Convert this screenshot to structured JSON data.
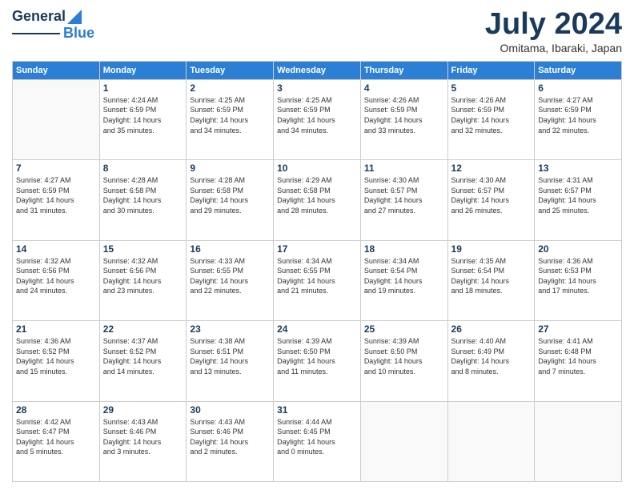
{
  "logo": {
    "line1": "General",
    "line2": "Blue"
  },
  "header": {
    "month": "July 2024",
    "location": "Omitama, Ibaraki, Japan"
  },
  "weekdays": [
    "Sunday",
    "Monday",
    "Tuesday",
    "Wednesday",
    "Thursday",
    "Friday",
    "Saturday"
  ],
  "weeks": [
    [
      {
        "day": "",
        "info": ""
      },
      {
        "day": "1",
        "info": "Sunrise: 4:24 AM\nSunset: 6:59 PM\nDaylight: 14 hours\nand 35 minutes."
      },
      {
        "day": "2",
        "info": "Sunrise: 4:25 AM\nSunset: 6:59 PM\nDaylight: 14 hours\nand 34 minutes."
      },
      {
        "day": "3",
        "info": "Sunrise: 4:25 AM\nSunset: 6:59 PM\nDaylight: 14 hours\nand 34 minutes."
      },
      {
        "day": "4",
        "info": "Sunrise: 4:26 AM\nSunset: 6:59 PM\nDaylight: 14 hours\nand 33 minutes."
      },
      {
        "day": "5",
        "info": "Sunrise: 4:26 AM\nSunset: 6:59 PM\nDaylight: 14 hours\nand 32 minutes."
      },
      {
        "day": "6",
        "info": "Sunrise: 4:27 AM\nSunset: 6:59 PM\nDaylight: 14 hours\nand 32 minutes."
      }
    ],
    [
      {
        "day": "7",
        "info": "Sunrise: 4:27 AM\nSunset: 6:59 PM\nDaylight: 14 hours\nand 31 minutes."
      },
      {
        "day": "8",
        "info": "Sunrise: 4:28 AM\nSunset: 6:58 PM\nDaylight: 14 hours\nand 30 minutes."
      },
      {
        "day": "9",
        "info": "Sunrise: 4:28 AM\nSunset: 6:58 PM\nDaylight: 14 hours\nand 29 minutes."
      },
      {
        "day": "10",
        "info": "Sunrise: 4:29 AM\nSunset: 6:58 PM\nDaylight: 14 hours\nand 28 minutes."
      },
      {
        "day": "11",
        "info": "Sunrise: 4:30 AM\nSunset: 6:57 PM\nDaylight: 14 hours\nand 27 minutes."
      },
      {
        "day": "12",
        "info": "Sunrise: 4:30 AM\nSunset: 6:57 PM\nDaylight: 14 hours\nand 26 minutes."
      },
      {
        "day": "13",
        "info": "Sunrise: 4:31 AM\nSunset: 6:57 PM\nDaylight: 14 hours\nand 25 minutes."
      }
    ],
    [
      {
        "day": "14",
        "info": "Sunrise: 4:32 AM\nSunset: 6:56 PM\nDaylight: 14 hours\nand 24 minutes."
      },
      {
        "day": "15",
        "info": "Sunrise: 4:32 AM\nSunset: 6:56 PM\nDaylight: 14 hours\nand 23 minutes."
      },
      {
        "day": "16",
        "info": "Sunrise: 4:33 AM\nSunset: 6:55 PM\nDaylight: 14 hours\nand 22 minutes."
      },
      {
        "day": "17",
        "info": "Sunrise: 4:34 AM\nSunset: 6:55 PM\nDaylight: 14 hours\nand 21 minutes."
      },
      {
        "day": "18",
        "info": "Sunrise: 4:34 AM\nSunset: 6:54 PM\nDaylight: 14 hours\nand 19 minutes."
      },
      {
        "day": "19",
        "info": "Sunrise: 4:35 AM\nSunset: 6:54 PM\nDaylight: 14 hours\nand 18 minutes."
      },
      {
        "day": "20",
        "info": "Sunrise: 4:36 AM\nSunset: 6:53 PM\nDaylight: 14 hours\nand 17 minutes."
      }
    ],
    [
      {
        "day": "21",
        "info": "Sunrise: 4:36 AM\nSunset: 6:52 PM\nDaylight: 14 hours\nand 15 minutes."
      },
      {
        "day": "22",
        "info": "Sunrise: 4:37 AM\nSunset: 6:52 PM\nDaylight: 14 hours\nand 14 minutes."
      },
      {
        "day": "23",
        "info": "Sunrise: 4:38 AM\nSunset: 6:51 PM\nDaylight: 14 hours\nand 13 minutes."
      },
      {
        "day": "24",
        "info": "Sunrise: 4:39 AM\nSunset: 6:50 PM\nDaylight: 14 hours\nand 11 minutes."
      },
      {
        "day": "25",
        "info": "Sunrise: 4:39 AM\nSunset: 6:50 PM\nDaylight: 14 hours\nand 10 minutes."
      },
      {
        "day": "26",
        "info": "Sunrise: 4:40 AM\nSunset: 6:49 PM\nDaylight: 14 hours\nand 8 minutes."
      },
      {
        "day": "27",
        "info": "Sunrise: 4:41 AM\nSunset: 6:48 PM\nDaylight: 14 hours\nand 7 minutes."
      }
    ],
    [
      {
        "day": "28",
        "info": "Sunrise: 4:42 AM\nSunset: 6:47 PM\nDaylight: 14 hours\nand 5 minutes."
      },
      {
        "day": "29",
        "info": "Sunrise: 4:43 AM\nSunset: 6:46 PM\nDaylight: 14 hours\nand 3 minutes."
      },
      {
        "day": "30",
        "info": "Sunrise: 4:43 AM\nSunset: 6:46 PM\nDaylight: 14 hours\nand 2 minutes."
      },
      {
        "day": "31",
        "info": "Sunrise: 4:44 AM\nSunset: 6:45 PM\nDaylight: 14 hours\nand 0 minutes."
      },
      {
        "day": "",
        "info": ""
      },
      {
        "day": "",
        "info": ""
      },
      {
        "day": "",
        "info": ""
      }
    ]
  ]
}
